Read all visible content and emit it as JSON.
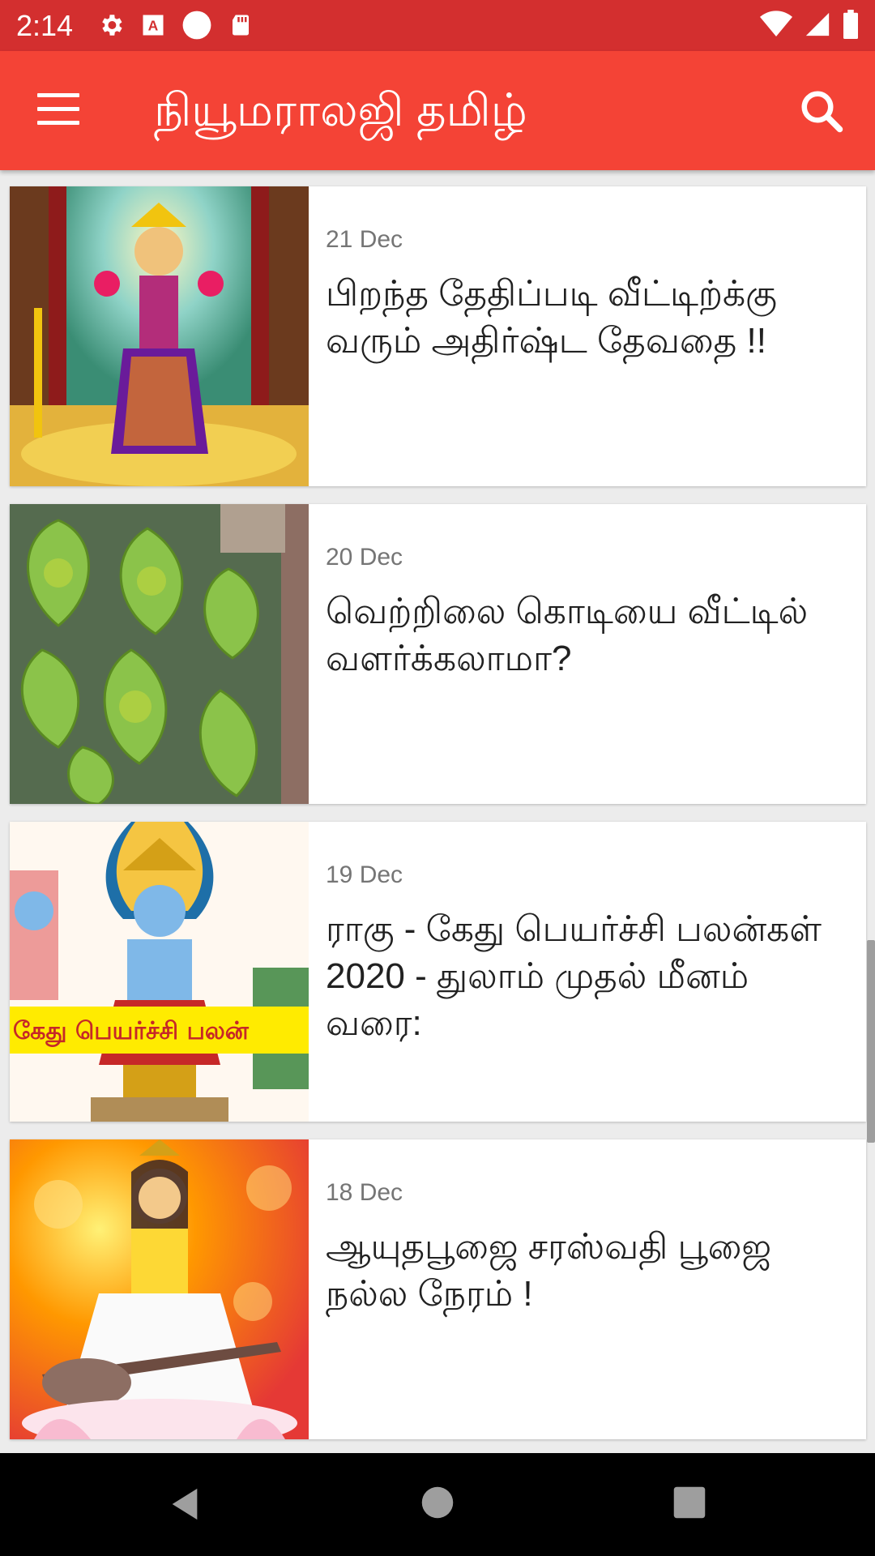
{
  "status_bar": {
    "time": "2:14",
    "left_icons": [
      "gear-icon",
      "text-a-icon",
      "circle-icon",
      "sd-card-icon"
    ],
    "right_icons": [
      "wifi-icon",
      "signal-icon",
      "battery-icon"
    ]
  },
  "app_bar": {
    "title": "நியூமராலஜி தமிழ்",
    "menu_icon": "menu-icon",
    "search_icon": "search-icon",
    "color": "#f44336"
  },
  "articles": [
    {
      "date": "21 Dec",
      "title": "பிறந்த தேதிப்படி வீட்டிற்க்கு வரும் அதிர்ஷ்ட தேவதை !!"
    },
    {
      "date": "20 Dec",
      "title": "வெற்றிலை கொடியை வீட்டில் வளர்க்கலாமா?"
    },
    {
      "date": "19 Dec",
      "title": "ராகு - கேது பெயர்ச்சி பலன்கள்  2020 - துலாம் முதல் மீனம் வரை:",
      "thumb_banner": "கேது பெயர்ச்சி பலன்"
    },
    {
      "date": "18 Dec",
      "title": "ஆயுதபூஜை சரஸ்வதி பூஜை நல்ல நேரம் !"
    }
  ],
  "nav_bar": {
    "buttons": [
      "back-icon",
      "home-icon",
      "recents-icon"
    ]
  }
}
